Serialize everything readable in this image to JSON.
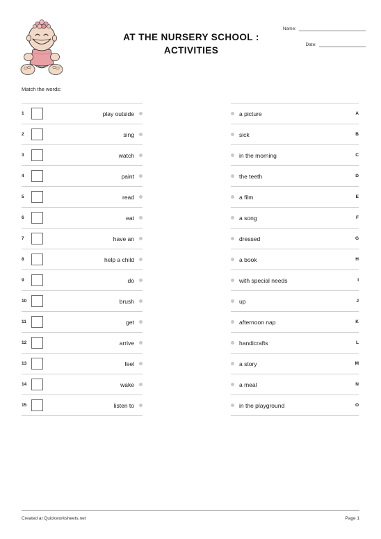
{
  "header": {
    "title_line1": "AT THE NURSERY SCHOOL :",
    "title_line2": "ACTIVITIES",
    "name_label": "Name:",
    "date_label": "Date:",
    "clipart_name": "sitting-baby-clipart",
    "clipart_colors": {
      "skin": "#f2d9c6",
      "dress": "#e8a0a4",
      "flower": "#e0909a",
      "outline": "#3a3a3a"
    }
  },
  "instruction": "Match the words:",
  "left_column": [
    {
      "number": "1",
      "word": "play outside"
    },
    {
      "number": "2",
      "word": "sing"
    },
    {
      "number": "3",
      "word": "watch"
    },
    {
      "number": "4",
      "word": "paint"
    },
    {
      "number": "5",
      "word": "read"
    },
    {
      "number": "6",
      "word": "eat"
    },
    {
      "number": "7",
      "word": "have an"
    },
    {
      "number": "8",
      "word": "help a child"
    },
    {
      "number": "9",
      "word": "do"
    },
    {
      "number": "10",
      "word": "brush"
    },
    {
      "number": "11",
      "word": "get"
    },
    {
      "number": "12",
      "word": "arrive"
    },
    {
      "number": "13",
      "word": "feel"
    },
    {
      "number": "14",
      "word": "wake"
    },
    {
      "number": "15",
      "word": "listen to"
    }
  ],
  "right_column": [
    {
      "letter": "A",
      "phrase": "a picture"
    },
    {
      "letter": "B",
      "phrase": "sick"
    },
    {
      "letter": "C",
      "phrase": "in the morning"
    },
    {
      "letter": "D",
      "phrase": "the teeth"
    },
    {
      "letter": "E",
      "phrase": "a film"
    },
    {
      "letter": "F",
      "phrase": "a song"
    },
    {
      "letter": "G",
      "phrase": "dressed"
    },
    {
      "letter": "H",
      "phrase": "a book"
    },
    {
      "letter": "I",
      "phrase": "with special needs"
    },
    {
      "letter": "J",
      "phrase": "up"
    },
    {
      "letter": "K",
      "phrase": "afternoon nap"
    },
    {
      "letter": "L",
      "phrase": "handicrafts"
    },
    {
      "letter": "M",
      "phrase": "a story"
    },
    {
      "letter": "N",
      "phrase": "a meal"
    },
    {
      "letter": "O",
      "phrase": "in the playground"
    }
  ],
  "footer": {
    "credit": "Created at Quickworksheets.net",
    "page": "Page 1"
  }
}
